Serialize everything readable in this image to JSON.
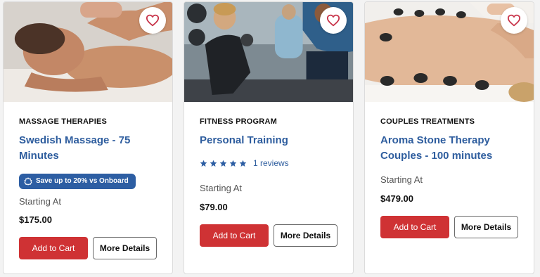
{
  "cards": [
    {
      "category": "MASSAGE THERAPIES",
      "title": "Swedish Massage - 75 Minutes",
      "badge": "Save up to 20% vs Onboard",
      "starting_label": "Starting At",
      "price": "$175.00",
      "add_to_cart": "Add to Cart",
      "more_details": "More Details"
    },
    {
      "category": "FITNESS PROGRAM",
      "title": "Personal Training",
      "rating": 5,
      "reviews": "1 reviews",
      "starting_label": "Starting At",
      "price": "$79.00",
      "add_to_cart": "Add to Cart",
      "more_details": "More Details"
    },
    {
      "category": "COUPLES TREATMENTS",
      "title": "Aroma Stone Therapy Couples - 100 minutes",
      "starting_label": "Starting At",
      "price": "$479.00",
      "add_to_cart": "Add to Cart",
      "more_details": "More Details"
    }
  ],
  "icons": {
    "favorite": "heart-outline-icon",
    "badge": "gear-icon",
    "rating": "star-icon"
  },
  "colors": {
    "accent_blue": "#2e5d9e",
    "badge_blue": "#2d5ea3",
    "cart_red": "#cf3234",
    "heart_red": "#c8344a",
    "text_dark": "#111111",
    "text_muted": "#555555"
  }
}
